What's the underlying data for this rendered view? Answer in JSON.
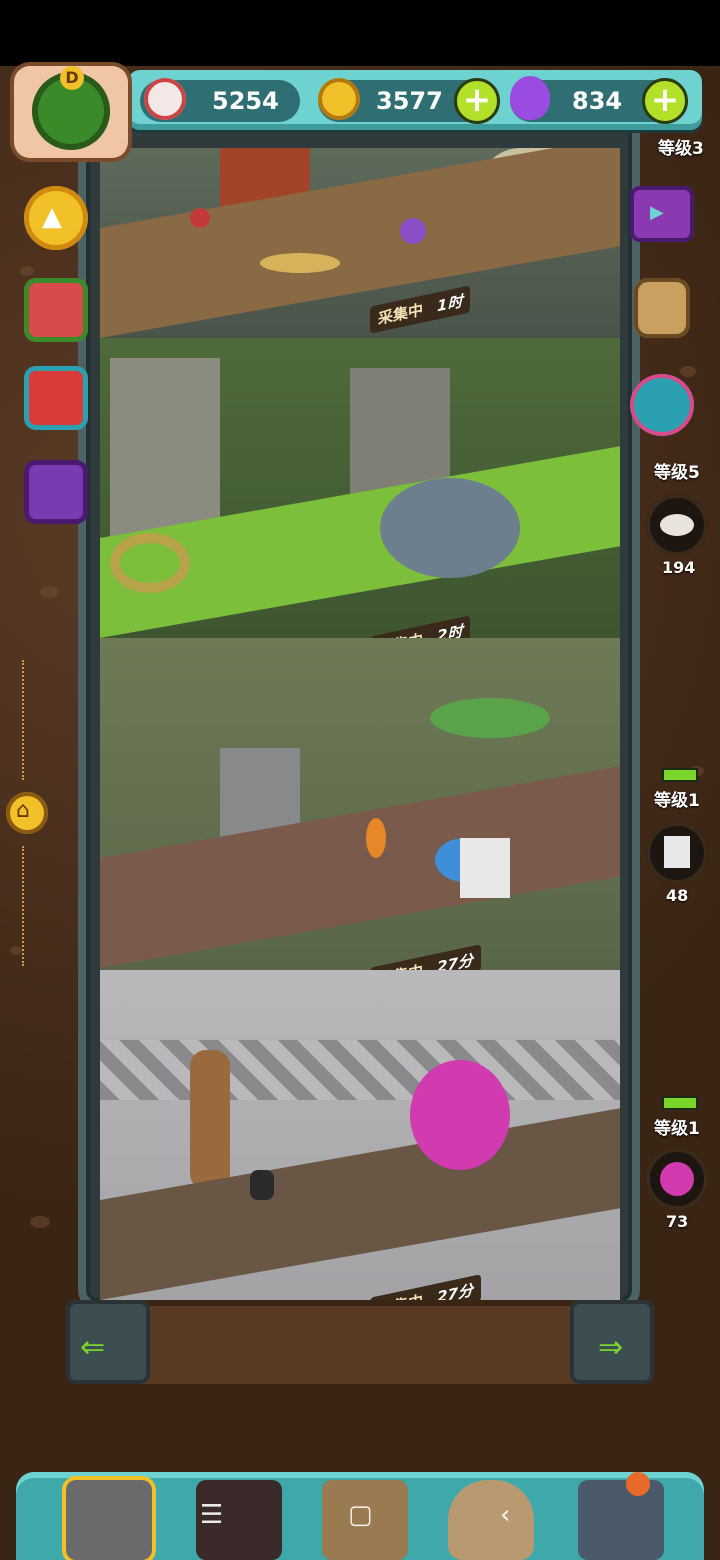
{
  "currencies": [
    {
      "name": "eyeball-currency",
      "value": "5254"
    },
    {
      "name": "gold-coin-currency",
      "value": "3577"
    },
    {
      "name": "potion-currency",
      "value": "834"
    }
  ],
  "avatar": {
    "badge": "D"
  },
  "floors": [
    {
      "name": "ruins-floor",
      "status": "采集中",
      "time": "1时"
    },
    {
      "name": "jungle-stone-floor",
      "status": "采集中",
      "time": "2时"
    },
    {
      "name": "vine-snail-floor",
      "status": "采集中",
      "time": "27分"
    },
    {
      "name": "tribal-onion-floor",
      "status": "采集中",
      "time": "27分"
    }
  ],
  "right_sidebar": {
    "partial_top_level": "等级3",
    "items": [
      {
        "name": "oyster-resource",
        "level": "等级5",
        "count": "194"
      },
      {
        "name": "milk-carton-resource",
        "level": "等级1",
        "count": "48"
      },
      {
        "name": "onion-resource",
        "level": "等级1",
        "count": "73"
      }
    ]
  },
  "colors": {
    "accent": "#6ed2d0",
    "plus": "#b3e12a",
    "panel": "#3fa8aa",
    "dirt": "#3a2414"
  }
}
